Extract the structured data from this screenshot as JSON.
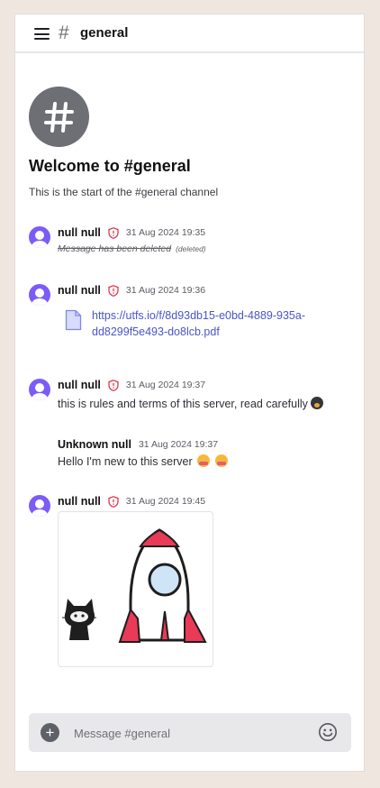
{
  "header": {
    "channel_name": "general",
    "hash_symbol": "#"
  },
  "welcome": {
    "avatar_symbol": "#",
    "title": "Welcome to #general",
    "subtitle": "This is the start of the #general channel"
  },
  "messages": [
    {
      "author": "null null",
      "role_icon": "shield-alert-icon",
      "timestamp": "31 Aug 2024 19:35",
      "deleted_text": "Message has been deleted",
      "deleted_tag": "(deleted)"
    },
    {
      "author": "null null",
      "role_icon": "shield-alert-icon",
      "timestamp": "31 Aug 2024 19:36",
      "file_link_line1": "https://utfs.io/f/8d93db15-e0bd-4889-935a-",
      "file_link_line2": "dd8299f5e493-do8lcb.pdf"
    },
    {
      "author": "null null",
      "role_icon": "shield-alert-icon",
      "timestamp": "31 Aug 2024 19:37",
      "content": "this is rules and terms of this server, read carefully",
      "emoji": "screaming-face"
    },
    {
      "author": "Unknown null",
      "timestamp": "31 Aug 2024 19:37",
      "content": "Hello I'm new to this server",
      "emoji": [
        "hugging-face",
        "hugging-face"
      ]
    },
    {
      "author": "null null",
      "role_icon": "shield-alert-icon",
      "timestamp": "31 Aug 2024 19:45",
      "attachment": "image-rocket-cat"
    }
  ],
  "composer": {
    "placeholder": "Message #general",
    "plus_symbol": "+"
  },
  "colors": {
    "page_bg": "#efe6e0",
    "avatar_purple": "#7c5cf6",
    "link_blue": "#4a55c9",
    "admin_red": "#e0364e",
    "welcome_avatar": "#6d6f75"
  }
}
